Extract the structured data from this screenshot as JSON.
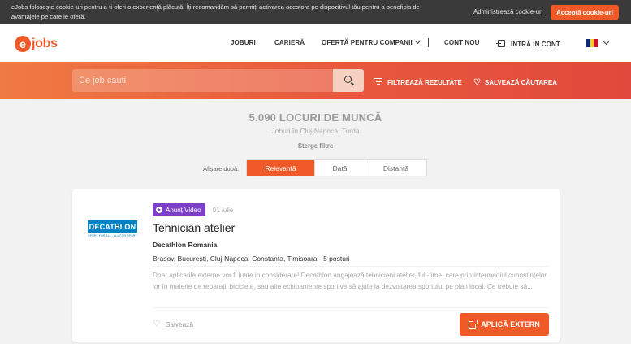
{
  "cookie": {
    "text": "eJobs folosește cookie-uri pentru a-ți oferi o experiență plăcută. Îți recomandăm să permiți activarea acestora pe dispozitivul tău pentru a beneficia de avantajele pe care le oferă.",
    "manage": "Administrează cookie-uri",
    "accept": "Acceptă cookie-uri"
  },
  "header": {
    "logo_letter": "e",
    "logo_text": "jobs",
    "nav": {
      "jobs": "JOBURI",
      "career": "CARIERĂ",
      "companies": "OFERTĂ PENTRU COMPANII",
      "new_account": "CONT NOU",
      "login": "INTRĂ ÎN CONT"
    },
    "flag_colors": [
      "#002b7f",
      "#fcd116",
      "#ce1126"
    ]
  },
  "search": {
    "placeholder": "Ce job cauți",
    "filter": "FILTREAZĂ REZULTATE",
    "save_search": "SALVEAZĂ CĂUTAREA"
  },
  "results": {
    "title": "5.090 LOCURI DE MUNCĂ",
    "subtitle": "Joburi în Cluj-Napoca, Turda",
    "clear_filters": "Șterge filtre",
    "sort_label": "Afișare după:",
    "sort_options": [
      "Relevanță",
      "Dată",
      "Distanță"
    ],
    "active_sort": "Relevanță"
  },
  "job": {
    "badge": "Anunț Video",
    "date": "01 iulie",
    "title": "Tehnician atelier",
    "company": "Decathlon Romania",
    "locations": "Brasov, Bucuresti, Cluj-Napoca, Constanta, Timisoara - 5 posturi",
    "description": "Doar aplicarile externe vor fi luate in considerare! Decathlon angajează tehnicieni atelier, full-time, care prin intermediul cunoștințelor lor în materie de reparații biciclete, sau alte echipamente sportive să ajute la dezvoltarea sportului pe plan local. Ce trebuie să...",
    "save": "Salvează",
    "apply": "APLICĂ EXTERN",
    "company_logo_text": "DECATHLON",
    "company_logo_tagline": "SPORT FOR ALL · ALL FOR SPORT",
    "brand_color": "#0082c3"
  },
  "colors": {
    "accent": "#f05a28",
    "video_badge": "#7b3fc8"
  }
}
